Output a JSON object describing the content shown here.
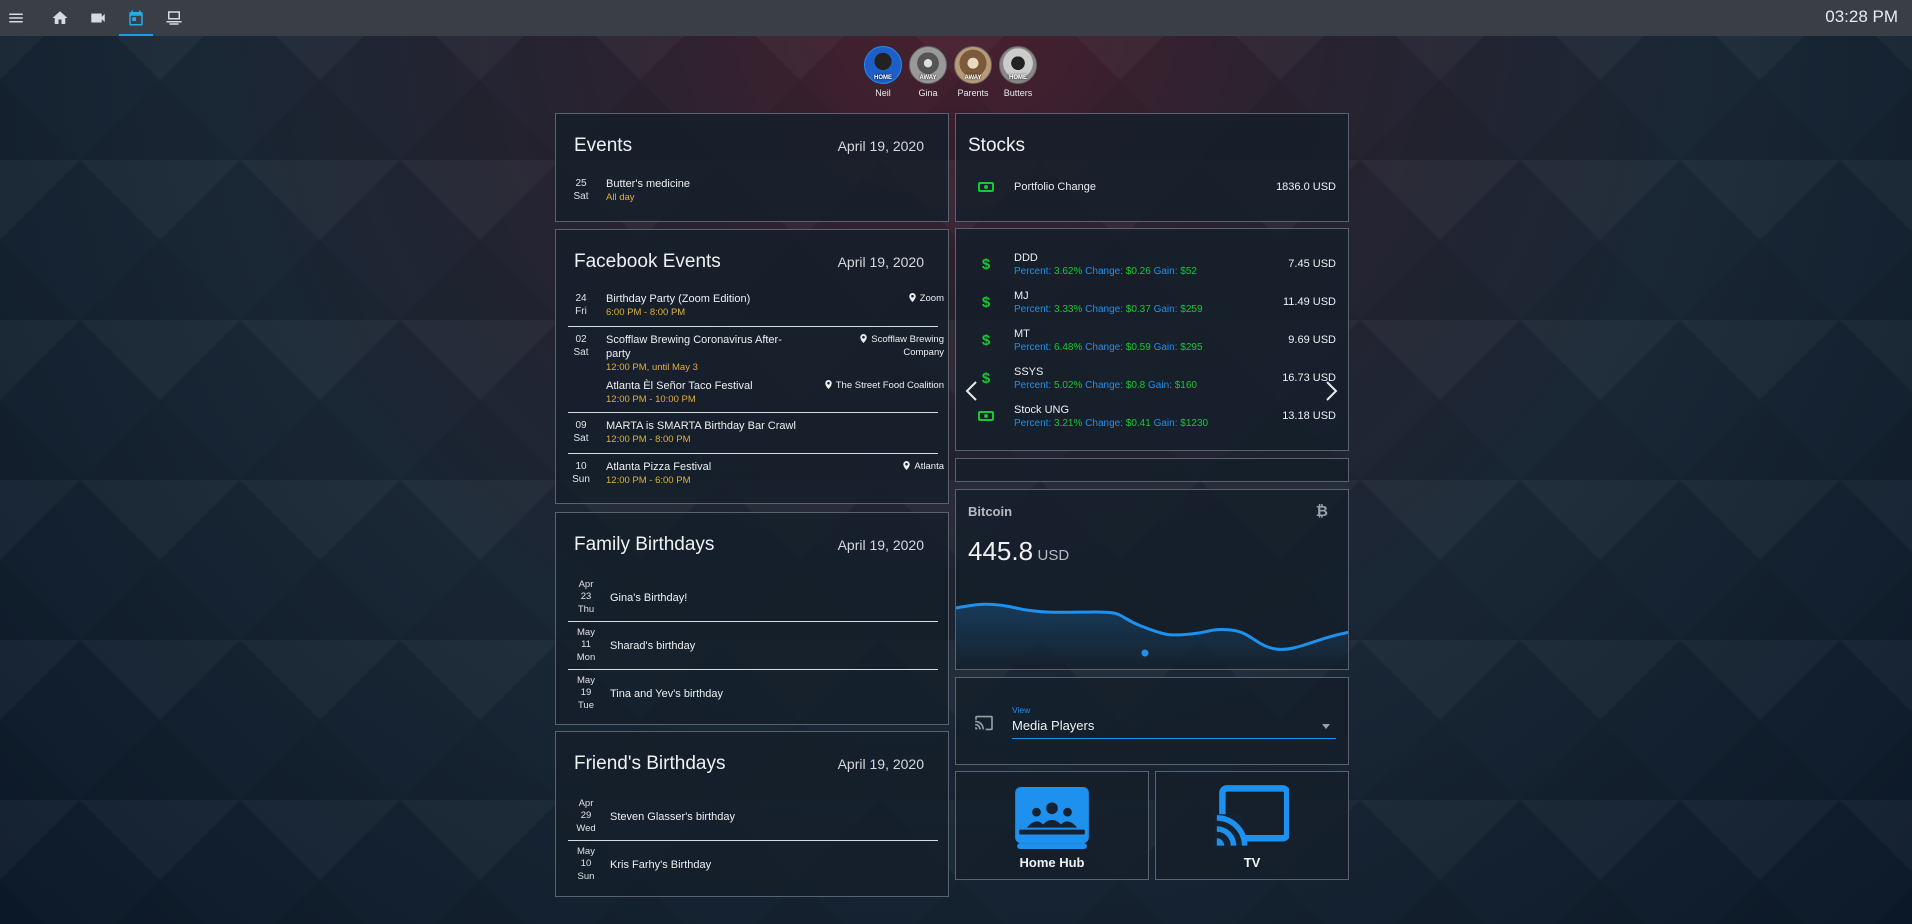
{
  "topbar": {
    "clock": "03:28 PM",
    "icons": [
      "menu-icon",
      "home-icon",
      "video-camera-icon",
      "calendar-icon",
      "laptop-icon"
    ]
  },
  "people": [
    {
      "name": "Neil",
      "status": "HOME"
    },
    {
      "name": "Gina",
      "status": "AWAY"
    },
    {
      "name": "Parents",
      "status": "AWAY"
    },
    {
      "name": "Butters",
      "status": "HOME"
    }
  ],
  "events": {
    "title": "Events",
    "date": "April 19, 2020",
    "items": [
      {
        "day_num": "25",
        "day_name": "Sat",
        "name": "Butter's medicine",
        "time": "All day"
      }
    ]
  },
  "facebook_events": {
    "title": "Facebook Events",
    "date": "April 19, 2020",
    "items": [
      {
        "day_num": "24",
        "day_name": "Fri",
        "name": "Birthday Party (Zoom Edition)",
        "time": "6:00 PM - 8:00 PM",
        "location": "Zoom"
      },
      {
        "day_num": "02",
        "day_name": "Sat",
        "name": "Scofflaw Brewing Coronavirus After-party",
        "time": "12:00 PM, until May 3",
        "location": "Scofflaw Brewing Company"
      },
      {
        "day_num": "",
        "day_name": "",
        "name": "Atlanta Èl Señor Taco Festival",
        "time": "12:00 PM - 10:00 PM",
        "location": "The Street Food Coalition"
      },
      {
        "day_num": "09",
        "day_name": "Sat",
        "name": "MARTA is SMARTA Birthday Bar Crawl",
        "time": "12:00 PM - 8:00 PM",
        "location": ""
      },
      {
        "day_num": "10",
        "day_name": "Sun",
        "name": "Atlanta Pizza Festival",
        "time": "12:00 PM - 6:00 PM",
        "location": "Atlanta"
      }
    ]
  },
  "family_birthdays": {
    "title": "Family Birthdays",
    "date": "April 19, 2020",
    "items": [
      {
        "month": "Apr",
        "day_num": "23",
        "day_name": "Thu",
        "name": "Gina's Birthday!"
      },
      {
        "month": "May",
        "day_num": "11",
        "day_name": "Mon",
        "name": "Sharad's birthday"
      },
      {
        "month": "May",
        "day_num": "19",
        "day_name": "Tue",
        "name": "Tina and Yev's birthday"
      }
    ]
  },
  "friend_birthdays": {
    "title": "Friend's Birthdays",
    "date": "April 19, 2020",
    "items": [
      {
        "month": "Apr",
        "day_num": "29",
        "day_name": "Wed",
        "name": "Steven Glasser's birthday"
      },
      {
        "month": "May",
        "day_num": "10",
        "day_name": "Sun",
        "name": "Kris Farhy's Birthday"
      }
    ]
  },
  "stocks": {
    "title": "Stocks",
    "portfolio_label": "Portfolio Change",
    "portfolio_value": "1836.0 USD",
    "items": [
      {
        "symbol": "DDD",
        "icon": "dollar-icon",
        "percent": "3.62%",
        "change": "$0.26",
        "gain": "$52",
        "value": "7.45 USD"
      },
      {
        "symbol": "MJ",
        "icon": "dollar-icon",
        "percent": "3.33%",
        "change": "$0.37",
        "gain": "$259",
        "value": "11.49 USD"
      },
      {
        "symbol": "MT",
        "icon": "dollar-icon",
        "percent": "6.48%",
        "change": "$0.59",
        "gain": "$295",
        "value": "9.69 USD"
      },
      {
        "symbol": "SSYS",
        "icon": "dollar-icon",
        "percent": "5.02%",
        "change": "$0.8",
        "gain": "$160",
        "value": "16.73 USD"
      },
      {
        "symbol": "Stock UNG",
        "icon": "money-icon",
        "percent": "3.21%",
        "change": "$0.41",
        "gain": "$1230",
        "value": "13.18 USD"
      }
    ],
    "labels": {
      "percent": "Percent:",
      "change": "Change:",
      "gain": "Gain:"
    }
  },
  "bitcoin": {
    "label": "Bitcoin",
    "value": "445.8",
    "unit": "USD",
    "line_color": "#1e90ee"
  },
  "media": {
    "select_label": "View",
    "select_value": "Media Players"
  },
  "tiles": [
    {
      "label": "Home Hub",
      "icon": "google-home-hub-icon"
    },
    {
      "label": "TV",
      "icon": "cast-icon"
    }
  ],
  "colors": {
    "accent": "#1e90ee",
    "green": "#18c734",
    "time": "#e0b03a"
  }
}
